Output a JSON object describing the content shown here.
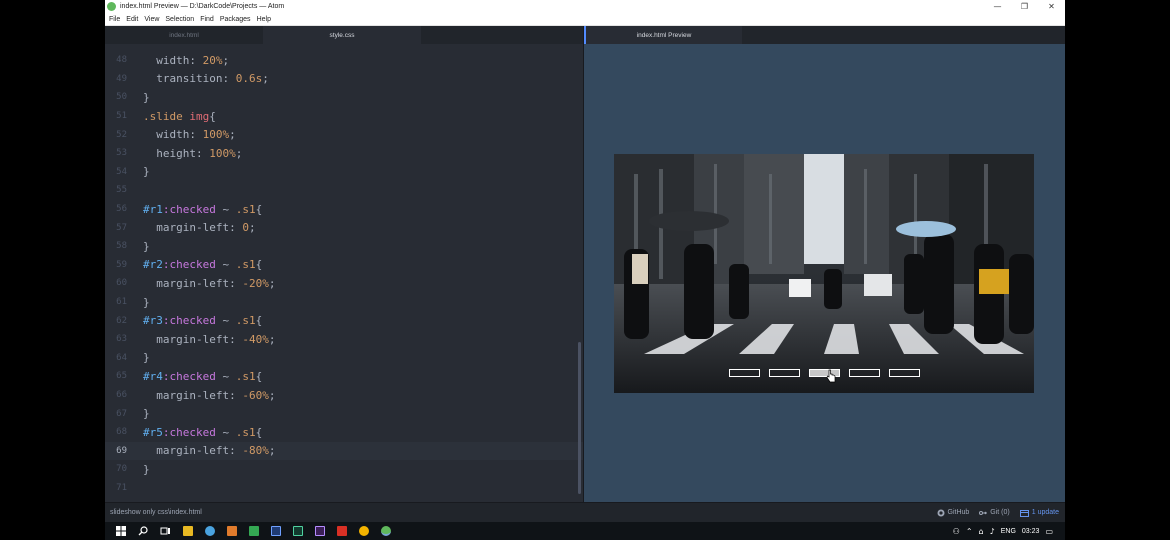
{
  "window": {
    "title": "index.html Preview — D:\\DarkCode\\Projects — Atom",
    "controls": [
      "—",
      "❐",
      "✕"
    ]
  },
  "menu": [
    "File",
    "Edit",
    "View",
    "Selection",
    "Find",
    "Packages",
    "Help"
  ],
  "editor_tabs": [
    {
      "label": "index.html",
      "active": false
    },
    {
      "label": "style.css",
      "active": true
    }
  ],
  "preview_tab": {
    "label": "index.html Preview"
  },
  "code_lines": [
    {
      "n": "48",
      "segments": [
        [
          "prop",
          "  width: "
        ],
        [
          "num",
          "20%"
        ],
        [
          "punct",
          ";"
        ]
      ]
    },
    {
      "n": "49",
      "segments": [
        [
          "prop",
          "  transition: "
        ],
        [
          "num",
          "0.6s"
        ],
        [
          "punct",
          ";"
        ]
      ]
    },
    {
      "n": "50",
      "segments": [
        [
          "punct",
          "}"
        ]
      ]
    },
    {
      "n": "51",
      "segments": [
        [
          "sel",
          ".slide "
        ],
        [
          "tag",
          "img"
        ],
        [
          "punct",
          "{"
        ]
      ]
    },
    {
      "n": "52",
      "segments": [
        [
          "prop",
          "  width: "
        ],
        [
          "num",
          "100%"
        ],
        [
          "punct",
          ";"
        ]
      ]
    },
    {
      "n": "53",
      "segments": [
        [
          "prop",
          "  height: "
        ],
        [
          "num",
          "100%"
        ],
        [
          "punct",
          ";"
        ]
      ]
    },
    {
      "n": "54",
      "segments": [
        [
          "punct",
          "}"
        ]
      ]
    },
    {
      "n": "55",
      "segments": []
    },
    {
      "n": "56",
      "segments": [
        [
          "id",
          "#r1"
        ],
        [
          "pseudo",
          ":checked"
        ],
        [
          "punct",
          " ~ "
        ],
        [
          "sel",
          ".s1"
        ],
        [
          "punct",
          "{"
        ]
      ]
    },
    {
      "n": "57",
      "segments": [
        [
          "prop",
          "  margin-left: "
        ],
        [
          "num",
          "0"
        ],
        [
          "punct",
          ";"
        ]
      ]
    },
    {
      "n": "58",
      "segments": [
        [
          "punct",
          "}"
        ]
      ]
    },
    {
      "n": "59",
      "segments": [
        [
          "id",
          "#r2"
        ],
        [
          "pseudo",
          ":checked"
        ],
        [
          "punct",
          " ~ "
        ],
        [
          "sel",
          ".s1"
        ],
        [
          "punct",
          "{"
        ]
      ]
    },
    {
      "n": "60",
      "segments": [
        [
          "prop",
          "  margin-left: "
        ],
        [
          "num",
          "-20%"
        ],
        [
          "punct",
          ";"
        ]
      ]
    },
    {
      "n": "61",
      "segments": [
        [
          "punct",
          "}"
        ]
      ]
    },
    {
      "n": "62",
      "segments": [
        [
          "id",
          "#r3"
        ],
        [
          "pseudo",
          ":checked"
        ],
        [
          "punct",
          " ~ "
        ],
        [
          "sel",
          ".s1"
        ],
        [
          "punct",
          "{"
        ]
      ]
    },
    {
      "n": "63",
      "segments": [
        [
          "prop",
          "  margin-left: "
        ],
        [
          "num",
          "-40%"
        ],
        [
          "punct",
          ";"
        ]
      ]
    },
    {
      "n": "64",
      "segments": [
        [
          "punct",
          "}"
        ]
      ]
    },
    {
      "n": "65",
      "segments": [
        [
          "id",
          "#r4"
        ],
        [
          "pseudo",
          ":checked"
        ],
        [
          "punct",
          " ~ "
        ],
        [
          "sel",
          ".s1"
        ],
        [
          "punct",
          "{"
        ]
      ]
    },
    {
      "n": "66",
      "segments": [
        [
          "prop",
          "  margin-left: "
        ],
        [
          "num",
          "-60%"
        ],
        [
          "punct",
          ";"
        ]
      ]
    },
    {
      "n": "67",
      "segments": [
        [
          "punct",
          "}"
        ]
      ]
    },
    {
      "n": "68",
      "segments": [
        [
          "id",
          "#r5"
        ],
        [
          "pseudo",
          ":checked"
        ],
        [
          "punct",
          " ~ "
        ],
        [
          "sel",
          ".s1"
        ],
        [
          "punct",
          "{"
        ]
      ]
    },
    {
      "n": "69",
      "segments": [
        [
          "prop",
          "  margin-left: "
        ],
        [
          "num",
          "-80%"
        ],
        [
          "punct",
          ";"
        ]
      ]
    },
    {
      "n": "70",
      "segments": [
        [
          "punct",
          "}"
        ]
      ]
    },
    {
      "n": "71",
      "segments": []
    }
  ],
  "cursor_line": "69",
  "slider": {
    "nav_count": 5,
    "active_index": 2
  },
  "statusbar": {
    "path": "slideshow only css\\index.html",
    "github": "GitHub",
    "git": "Git (0)",
    "update": "1 update"
  },
  "taskbar": {
    "language": "ENG",
    "time": "03:23"
  },
  "colors": {
    "editor_bg": "#282c34",
    "preview_bg": "#34495e",
    "accent": "#528bff"
  }
}
